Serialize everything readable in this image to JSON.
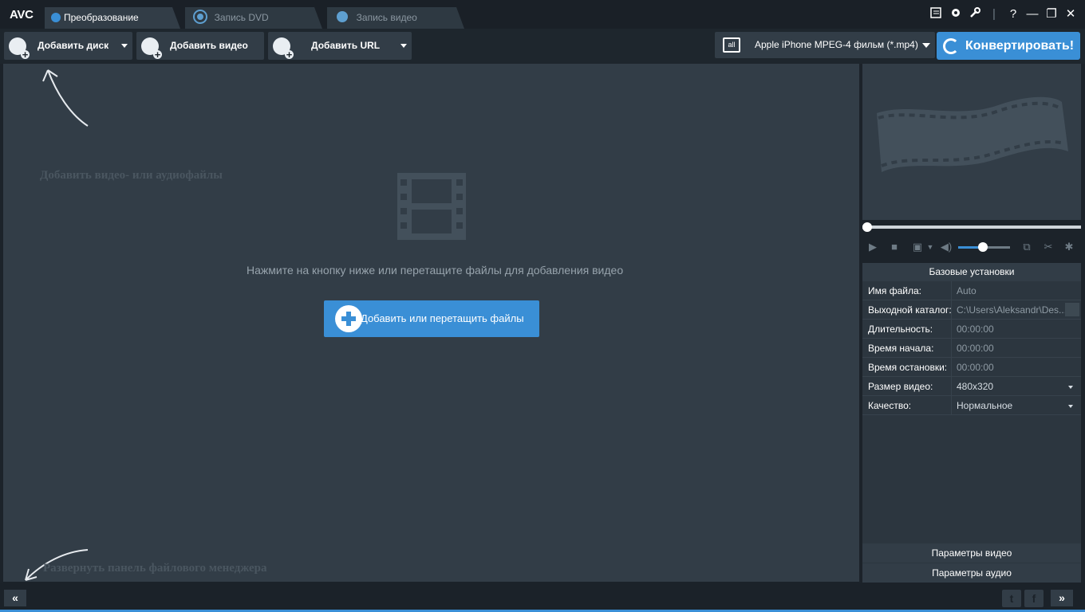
{
  "app": {
    "logo": "AVC",
    "tabs": [
      {
        "label": "Преобразование",
        "active": true,
        "icon": "refresh-icon"
      },
      {
        "label": "Запись DVD",
        "active": false,
        "icon": "disc-icon"
      },
      {
        "label": "Запись видео",
        "active": false,
        "icon": "play-icon"
      }
    ],
    "window_controls": {
      "minimize": "—",
      "restore": "❐",
      "close": "✕",
      "help": "?",
      "separator": "|"
    }
  },
  "toolbar": {
    "add_disc_label": "Добавить диск",
    "add_video_label": "Добавить видео",
    "add_url_label": "Добавить URL",
    "profile_label": "Apple iPhone MPEG-4 фильм (*.mp4)",
    "profile_icon_text": "all",
    "convert_label": "Конвертировать!"
  },
  "main": {
    "hint_add": "Добавить видео- или аудиофайлы",
    "drop_text": "Нажмите на кнопку ниже или перетащите файлы для добавления видео",
    "add_files_label": "Добавить или перетащить файлы",
    "hint_expand": "Развернуть панель файлового менеджера"
  },
  "player": {
    "seek_position": 0,
    "volume_fraction": 0.5
  },
  "settings": {
    "title": "Базовые установки",
    "rows": [
      {
        "key": "Имя файла:",
        "value": "Auto"
      },
      {
        "key": "Выходной каталог:",
        "value": "C:\\Users\\Aleksandr\\Des..."
      },
      {
        "key": "Длительность:",
        "value": "00:00:00"
      },
      {
        "key": "Время начала:",
        "value": "00:00:00"
      },
      {
        "key": "Время остановки:",
        "value": "00:00:00"
      },
      {
        "key": "Размер видео:",
        "value": "480x320"
      },
      {
        "key": "Качество:",
        "value": "Нормальное"
      }
    ],
    "video_params_label": "Параметры видео",
    "audio_params_label": "Параметры аудио"
  },
  "bottom": {
    "collapse_label": "«",
    "expand_label": "»",
    "twitter_label": "t",
    "facebook_label": "f"
  },
  "colors": {
    "accent": "#3a8fd6",
    "panel": "#323d47",
    "background": "#1c232a"
  }
}
